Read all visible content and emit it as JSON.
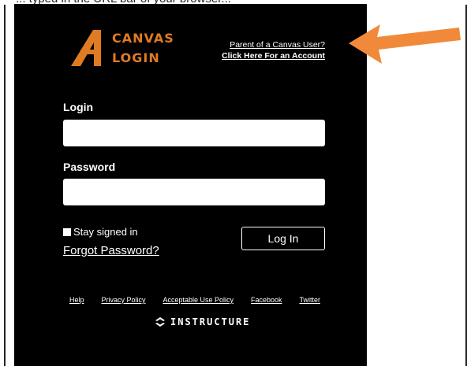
{
  "top_text": "... typed in the URL bar of your browser...",
  "logo": {
    "line1": "CANVAS",
    "line2": "LOGIN"
  },
  "parent_links": {
    "line1": "Parent of a Canvas User?",
    "line2": "Click Here For an Account"
  },
  "form": {
    "login_label": "Login",
    "login_value": "",
    "password_label": "Password",
    "password_value": "",
    "stay_signed_in": "Stay signed in",
    "forgot_password": "Forgot Password?",
    "login_button": "Log In"
  },
  "footer": {
    "links": [
      "Help",
      "Privacy Policy",
      "Acceptable Use Policy",
      "Facebook",
      "Twitter"
    ],
    "brand": "INSTRUCTURE"
  },
  "colors": {
    "accent": "#e07b22",
    "arrow": "#f08a3a",
    "panel_bg": "#000000"
  }
}
